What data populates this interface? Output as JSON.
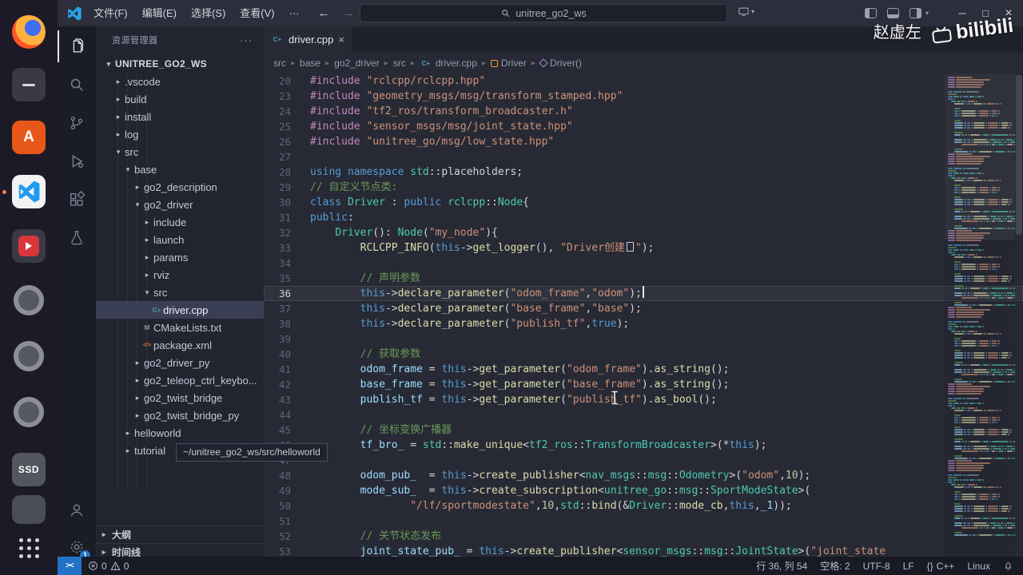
{
  "colors": {
    "accent_blue": "#2472c8",
    "editor_bg": "#272a35",
    "sidebar_bg": "#22242f",
    "statusbar_bg": "#181a24",
    "titlebar_bg": "#2c2e3b",
    "selection": "#3b3f55",
    "vscode_blue": "#1f9cf0",
    "dock_bg": "#1d1a27"
  },
  "icons": {
    "chevron_down": "▾",
    "chevron_right": "▸",
    "more": "···",
    "back": "←",
    "forward": "→",
    "minimize": "─",
    "maximize": "□",
    "close": "×",
    "tab_close": "×",
    "caret_down": "▾",
    "remote": "><"
  },
  "dock": {
    "app_a_label": "A",
    "ssd_label": "SSD"
  },
  "titlebar": {
    "menus": [
      "文件(F)",
      "编辑(E)",
      "选择(S)",
      "查看(V)",
      "···"
    ],
    "search_value": "unitree_go2_ws"
  },
  "watermark": {
    "author": "赵虚左",
    "brand": "bilibili"
  },
  "activity": {
    "badge": "1"
  },
  "sidebar": {
    "title": "资源管理器",
    "tooltip": "~/unitree_go2_ws/src/helloworld",
    "bottom_sections": [
      "大纲",
      "时间线"
    ],
    "tree": [
      {
        "label": "UNITREE_GO2_WS",
        "level": 0,
        "chevron": "down",
        "bold": true
      },
      {
        "label": ".vscode",
        "level": 1,
        "chevron": "right"
      },
      {
        "label": "build",
        "level": 1,
        "chevron": "right"
      },
      {
        "label": "install",
        "level": 1,
        "chevron": "right"
      },
      {
        "label": "log",
        "level": 1,
        "chevron": "right"
      },
      {
        "label": "src",
        "level": 1,
        "chevron": "down"
      },
      {
        "label": "base",
        "level": 2,
        "chevron": "down"
      },
      {
        "label": "go2_description",
        "level": 3,
        "chevron": "right"
      },
      {
        "label": "go2_driver",
        "level": 3,
        "chevron": "down"
      },
      {
        "label": "include",
        "level": 4,
        "chevron": "right"
      },
      {
        "label": "launch",
        "level": 4,
        "chevron": "right"
      },
      {
        "label": "params",
        "level": 4,
        "chevron": "right"
      },
      {
        "label": "rviz",
        "level": 4,
        "chevron": "right"
      },
      {
        "label": "src",
        "level": 4,
        "chevron": "down"
      },
      {
        "label": "driver.cpp",
        "level": 5,
        "icon": "cpp",
        "selected": true
      },
      {
        "label": "CMakeLists.txt",
        "level": 4,
        "icon": "cmake"
      },
      {
        "label": "package.xml",
        "level": 4,
        "icon": "xml"
      },
      {
        "label": "go2_driver_py",
        "level": 3,
        "chevron": "right"
      },
      {
        "label": "go2_teleop_ctrl_keybo...",
        "level": 3,
        "chevron": "right"
      },
      {
        "label": "go2_twist_bridge",
        "level": 3,
        "chevron": "right"
      },
      {
        "label": "go2_twist_bridge_py",
        "level": 3,
        "chevron": "right"
      },
      {
        "label": "helloworld",
        "level": 2,
        "chevron": "right"
      },
      {
        "label": "tutorial",
        "level": 2,
        "chevron": "right"
      }
    ]
  },
  "editor": {
    "tab": "driver.cpp",
    "current_line": 36,
    "breadcrumbs": [
      {
        "label": "src"
      },
      {
        "label": "base"
      },
      {
        "label": "go2_driver"
      },
      {
        "label": "src"
      },
      {
        "label": "driver.cpp",
        "icon": "cpp"
      },
      {
        "label": "Driver",
        "icon": "class"
      },
      {
        "label": "Driver()",
        "icon": "method"
      }
    ],
    "lines": [
      {
        "n": 20,
        "tk": [
          [
            "pp",
            "#include "
          ],
          [
            "s",
            "\"rclcpp/rclcpp.hpp\""
          ]
        ]
      },
      {
        "n": 23,
        "tk": [
          [
            "pp",
            "#include "
          ],
          [
            "s",
            "\"geometry_msgs/msg/transform_stamped.hpp\""
          ]
        ]
      },
      {
        "n": 24,
        "tk": [
          [
            "pp",
            "#include "
          ],
          [
            "s",
            "\"tf2_ros/transform_broadcaster.h\""
          ]
        ]
      },
      {
        "n": 25,
        "tk": [
          [
            "pp",
            "#include "
          ],
          [
            "s",
            "\"sensor_msgs/msg/joint_state.hpp\""
          ]
        ]
      },
      {
        "n": 26,
        "tk": [
          [
            "pp",
            "#include "
          ],
          [
            "s",
            "\"unitree_go/msg/low_state.hpp\""
          ]
        ]
      },
      {
        "n": 27,
        "tk": []
      },
      {
        "n": 28,
        "tk": [
          [
            "k",
            "using "
          ],
          [
            "k",
            "namespace "
          ],
          [
            "t",
            "std"
          ],
          [
            "p",
            "::placeholders;"
          ]
        ]
      },
      {
        "n": 29,
        "tk": [
          [
            "c",
            "// 自定义节点类:"
          ]
        ]
      },
      {
        "n": 30,
        "tk": [
          [
            "k",
            "class "
          ],
          [
            "t",
            "Driver"
          ],
          [
            "p",
            " : "
          ],
          [
            "k",
            "public "
          ],
          [
            "t",
            "rclcpp"
          ],
          [
            "p",
            "::"
          ],
          [
            "t",
            "Node"
          ],
          [
            "p",
            "{"
          ]
        ]
      },
      {
        "n": 31,
        "tk": [
          [
            "k",
            "public"
          ],
          [
            "p",
            ":"
          ]
        ]
      },
      {
        "n": 32,
        "tk": [
          [
            "p",
            "    "
          ],
          [
            "t",
            "Driver"
          ],
          [
            "p",
            "(): "
          ],
          [
            "t",
            "Node"
          ],
          [
            "p",
            "("
          ],
          [
            "s",
            "\"my_node\""
          ],
          [
            "p",
            "){"
          ]
        ]
      },
      {
        "n": 33,
        "tk": [
          [
            "p",
            "        "
          ],
          [
            "f",
            "RCLCPP_INFO"
          ],
          [
            "p",
            "("
          ],
          [
            "k",
            "this"
          ],
          [
            "p",
            "->"
          ],
          [
            "f",
            "get_logger"
          ],
          [
            "p",
            "(), "
          ],
          [
            "s",
            "\"Driver创建"
          ],
          [
            "x",
            ""
          ],
          [
            "s",
            "\""
          ],
          [
            "p",
            ");"
          ]
        ]
      },
      {
        "n": 34,
        "tk": []
      },
      {
        "n": 35,
        "tk": [
          [
            "p",
            "        "
          ],
          [
            "c",
            "// 声明参数"
          ]
        ]
      },
      {
        "n": 36,
        "tk": [
          [
            "p",
            "        "
          ],
          [
            "k",
            "this"
          ],
          [
            "p",
            "->"
          ],
          [
            "f",
            "declare_parameter"
          ],
          [
            "p",
            "("
          ],
          [
            "s",
            "\"odom_frame\""
          ],
          [
            "p",
            ","
          ],
          [
            "s",
            "\"odom\""
          ],
          [
            "p",
            ");"
          ]
        ]
      },
      {
        "n": 37,
        "tk": [
          [
            "p",
            "        "
          ],
          [
            "k",
            "this"
          ],
          [
            "p",
            "->"
          ],
          [
            "f",
            "declare_parameter"
          ],
          [
            "p",
            "("
          ],
          [
            "s",
            "\"base_frame\""
          ],
          [
            "p",
            ","
          ],
          [
            "s",
            "\"base\""
          ],
          [
            "p",
            ");"
          ]
        ]
      },
      {
        "n": 38,
        "tk": [
          [
            "p",
            "        "
          ],
          [
            "k",
            "this"
          ],
          [
            "p",
            "->"
          ],
          [
            "f",
            "declare_parameter"
          ],
          [
            "p",
            "("
          ],
          [
            "s",
            "\"publish_tf\""
          ],
          [
            "p",
            ","
          ],
          [
            "k",
            "true"
          ],
          [
            "p",
            ");"
          ]
        ]
      },
      {
        "n": 39,
        "tk": []
      },
      {
        "n": 40,
        "tk": [
          [
            "p",
            "        "
          ],
          [
            "c",
            "// 获取参数"
          ]
        ]
      },
      {
        "n": 41,
        "tk": [
          [
            "p",
            "        "
          ],
          [
            "v",
            "odom_frame"
          ],
          [
            "p",
            " = "
          ],
          [
            "k",
            "this"
          ],
          [
            "p",
            "->"
          ],
          [
            "f",
            "get_parameter"
          ],
          [
            "p",
            "("
          ],
          [
            "s",
            "\"odom_frame\""
          ],
          [
            "p",
            ")."
          ],
          [
            "f",
            "as_string"
          ],
          [
            "p",
            "();"
          ]
        ]
      },
      {
        "n": 42,
        "tk": [
          [
            "p",
            "        "
          ],
          [
            "v",
            "base_frame"
          ],
          [
            "p",
            " = "
          ],
          [
            "k",
            "this"
          ],
          [
            "p",
            "->"
          ],
          [
            "f",
            "get_parameter"
          ],
          [
            "p",
            "("
          ],
          [
            "s",
            "\"base_frame\""
          ],
          [
            "p",
            ")."
          ],
          [
            "f",
            "as_string"
          ],
          [
            "p",
            "();"
          ]
        ]
      },
      {
        "n": 43,
        "tk": [
          [
            "p",
            "        "
          ],
          [
            "v",
            "publish_tf"
          ],
          [
            "p",
            " = "
          ],
          [
            "k",
            "this"
          ],
          [
            "p",
            "->"
          ],
          [
            "f",
            "get_parameter"
          ],
          [
            "p",
            "("
          ],
          [
            "s",
            "\"publish_tf\""
          ],
          [
            "p",
            ")."
          ],
          [
            "f",
            "as_bool"
          ],
          [
            "p",
            "();"
          ]
        ]
      },
      {
        "n": 44,
        "tk": []
      },
      {
        "n": 45,
        "tk": [
          [
            "p",
            "        "
          ],
          [
            "c",
            "// 坐标变换广播器"
          ]
        ]
      },
      {
        "n": 46,
        "tk": [
          [
            "p",
            "        "
          ],
          [
            "v",
            "tf_bro_"
          ],
          [
            "p",
            " = "
          ],
          [
            "t",
            "std"
          ],
          [
            "p",
            "::"
          ],
          [
            "f",
            "make_unique"
          ],
          [
            "p",
            "<"
          ],
          [
            "t",
            "tf2_ros"
          ],
          [
            "p",
            "::"
          ],
          [
            "t",
            "TransformBroadcaster"
          ],
          [
            "p",
            ">(*"
          ],
          [
            "k",
            "this"
          ],
          [
            "p",
            ");"
          ]
        ]
      },
      {
        "n": 47,
        "tk": []
      },
      {
        "n": 48,
        "tk": [
          [
            "p",
            "        "
          ],
          [
            "v",
            "odom_pub_"
          ],
          [
            "p",
            "  = "
          ],
          [
            "k",
            "this"
          ],
          [
            "p",
            "->"
          ],
          [
            "f",
            "create_publisher"
          ],
          [
            "p",
            "<"
          ],
          [
            "t",
            "nav_msgs"
          ],
          [
            "p",
            "::"
          ],
          [
            "t",
            "msg"
          ],
          [
            "p",
            "::"
          ],
          [
            "t",
            "Odometry"
          ],
          [
            "p",
            ">("
          ],
          [
            "s",
            "\"odom\""
          ],
          [
            "p",
            ","
          ],
          [
            "num",
            "10"
          ],
          [
            "p",
            ");"
          ]
        ]
      },
      {
        "n": 49,
        "tk": [
          [
            "p",
            "        "
          ],
          [
            "v",
            "mode_sub_"
          ],
          [
            "p",
            "  = "
          ],
          [
            "k",
            "this"
          ],
          [
            "p",
            "->"
          ],
          [
            "f",
            "create_subscription"
          ],
          [
            "p",
            "<"
          ],
          [
            "t",
            "unitree_go"
          ],
          [
            "p",
            "::"
          ],
          [
            "t",
            "msg"
          ],
          [
            "p",
            "::"
          ],
          [
            "t",
            "SportModeState"
          ],
          [
            "p",
            ">("
          ]
        ]
      },
      {
        "n": 50,
        "tk": [
          [
            "p",
            "                "
          ],
          [
            "s",
            "\"/lf/sportmodestate\""
          ],
          [
            "p",
            ","
          ],
          [
            "num",
            "10"
          ],
          [
            "p",
            ","
          ],
          [
            "t",
            "std"
          ],
          [
            "p",
            "::"
          ],
          [
            "f",
            "bind"
          ],
          [
            "p",
            "(&"
          ],
          [
            "t",
            "Driver"
          ],
          [
            "p",
            "::"
          ],
          [
            "f",
            "mode_cb"
          ],
          [
            "p",
            ","
          ],
          [
            "k",
            "this"
          ],
          [
            "p",
            ","
          ],
          [
            "v",
            "_1"
          ],
          [
            "p",
            "));"
          ]
        ]
      },
      {
        "n": 51,
        "tk": []
      },
      {
        "n": 52,
        "tk": [
          [
            "p",
            "        "
          ],
          [
            "c",
            "// 关节状态发布"
          ]
        ]
      },
      {
        "n": 53,
        "tk": [
          [
            "p",
            "        "
          ],
          [
            "v",
            "joint_state_pub_"
          ],
          [
            "p",
            " = "
          ],
          [
            "k",
            "this"
          ],
          [
            "p",
            "->"
          ],
          [
            "f",
            "create_publisher"
          ],
          [
            "p",
            "<"
          ],
          [
            "t",
            "sensor_msgs"
          ],
          [
            "p",
            "::"
          ],
          [
            "t",
            "msg"
          ],
          [
            "p",
            "::"
          ],
          [
            "t",
            "JointState"
          ],
          [
            "p",
            ">("
          ],
          [
            "s",
            "\"joint_state"
          ]
        ]
      }
    ]
  },
  "statusbar": {
    "errors": "0",
    "warnings": "0",
    "cursor": "行 36, 列 54",
    "indent": "空格: 2",
    "encoding": "UTF-8",
    "eol": "LF",
    "language_icon": "{}",
    "language": "C++",
    "remote_os": "Linux"
  }
}
